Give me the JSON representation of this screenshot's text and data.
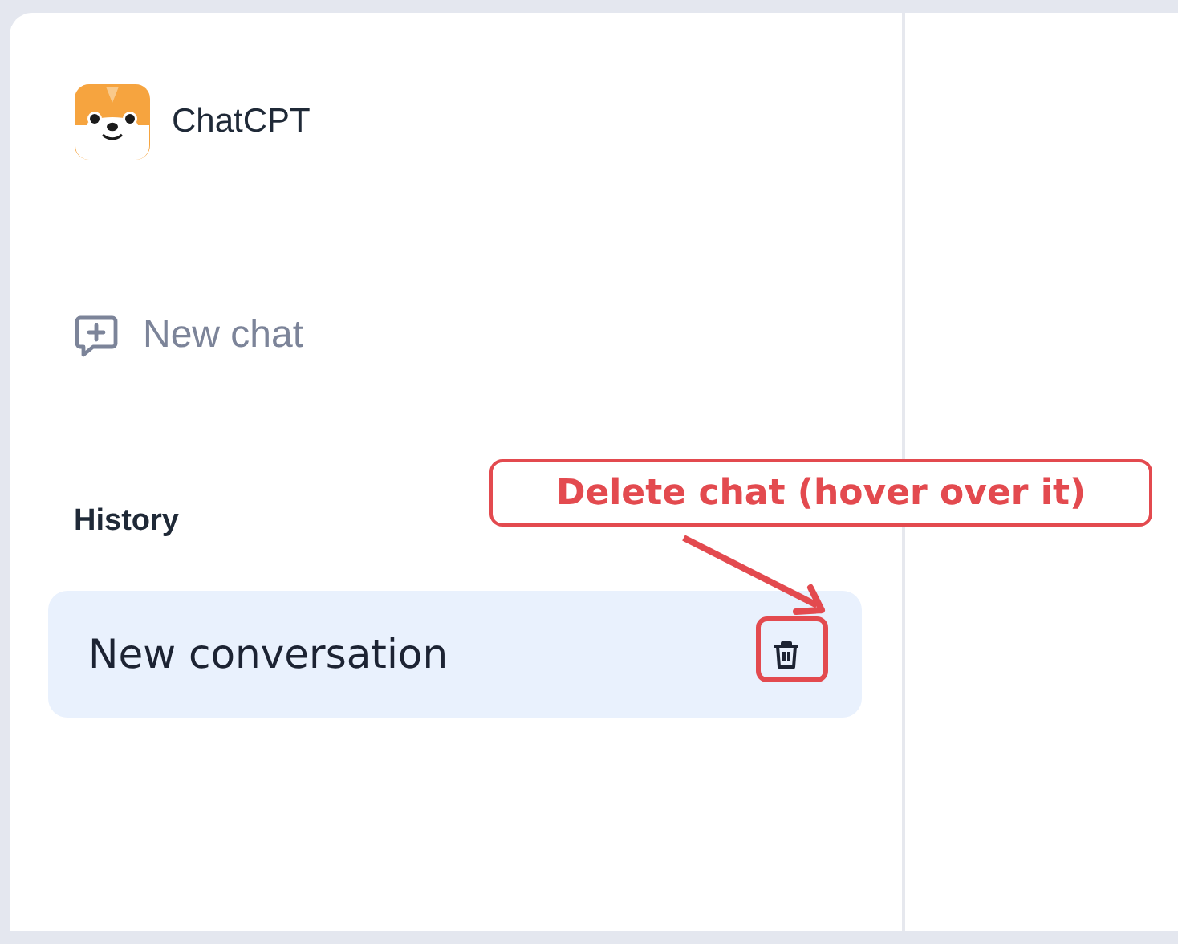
{
  "app": {
    "name": "ChatCPT"
  },
  "new_chat": {
    "label": "New chat"
  },
  "history": {
    "heading": "History",
    "items": [
      {
        "title": "New conversation",
        "selected": true
      }
    ]
  },
  "annotation": {
    "text": "Delete chat (hover over it)"
  }
}
